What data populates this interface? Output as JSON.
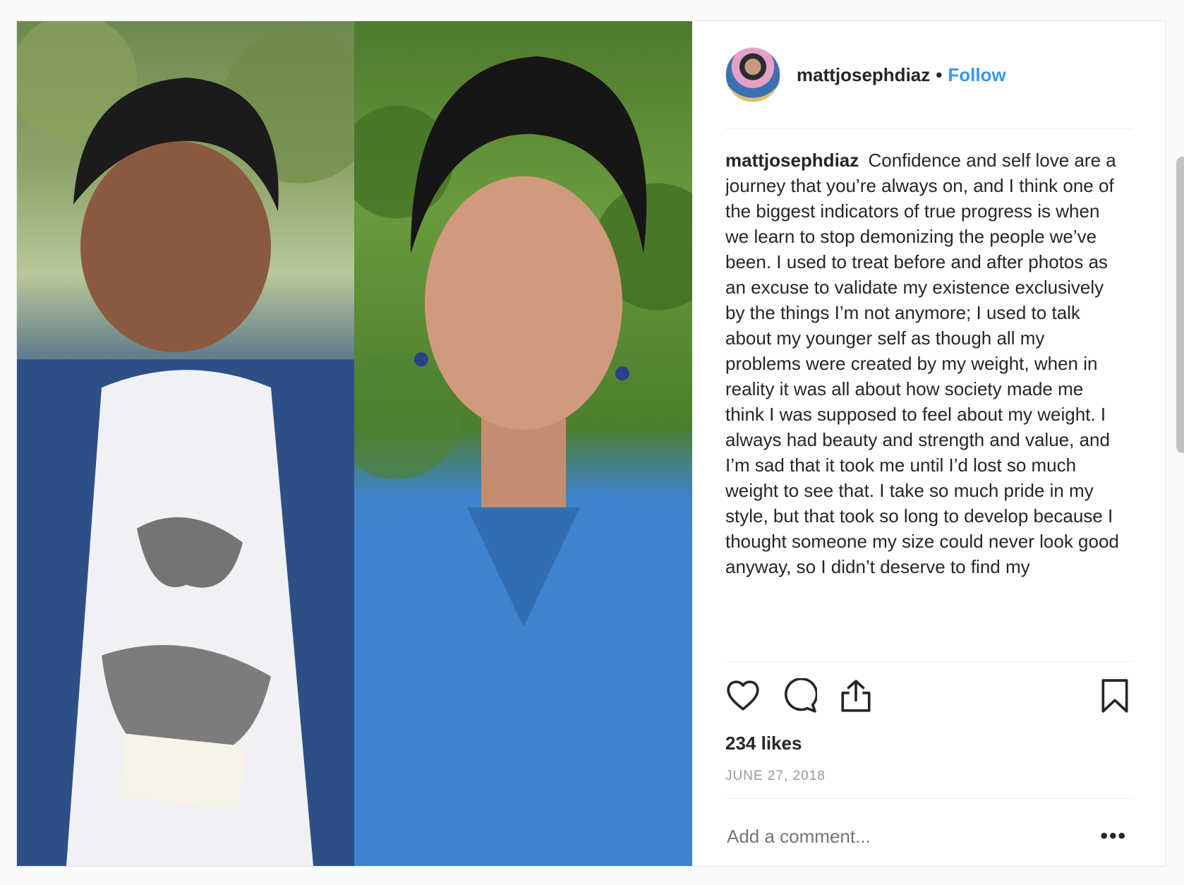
{
  "post": {
    "username": "mattjosephdiaz",
    "separator": "•",
    "follow_label": "Follow",
    "caption_username": "mattjosephdiaz",
    "caption_text": "Confidence and self love are a journey that you’re always on, and I think one of the biggest indicators of true progress is when we learn to stop demonizing the people we’ve been. I used to treat before and after photos as an excuse to validate my existence exclusively by the things I’m not anymore; I used to talk about my younger self as though all my problems were created by my weight, when in reality it was all about how society made me think I was supposed to feel about my weight. I always had beauty and strength and value, and I’m sad that it took me until I’d lost so much weight to see that. I take so much pride in my style, but that took so long to develop because I thought someone my size could never look good anyway, so I didn’t deserve to find my",
    "likes": "234 likes",
    "date": "JUNE 27, 2018",
    "comment_placeholder": "Add a comment...",
    "more_label": "•••"
  },
  "icons": [
    "heart-icon",
    "comment-icon",
    "share-icon",
    "bookmark-icon"
  ],
  "colors": {
    "accent": "#3897f0",
    "text": "#262626",
    "muted": "#999999"
  }
}
